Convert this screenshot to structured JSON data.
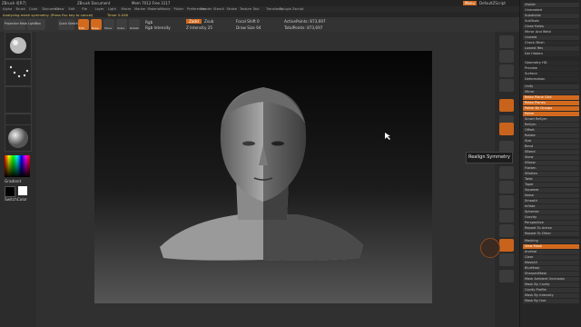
{
  "title_bar": {
    "app": "ZBrush 4[R7]",
    "doc": "ZBrush Document",
    "mem": "Mem 7012 Free 3117",
    "menu_btn": "Menu",
    "script_btn": "DefaultZScript"
  },
  "menus": [
    "Alpha",
    "Brush",
    "Color",
    "Document",
    "Draw",
    "Edit",
    "File",
    "Layer",
    "Light",
    "Macro",
    "Marker",
    "Material",
    "Movie",
    "Picker",
    "Preferences",
    "Render",
    "Stencil",
    "Stroke",
    "Texture",
    "Tool",
    "Transform",
    "Zplugin",
    "Zscript"
  ],
  "status": {
    "message": "Analyzing mesh symmetry. (Press Esc key to cancel)",
    "timer": "Timer 0.046"
  },
  "toolbar": {
    "rgb_label": "Rgb",
    "rgb_intensity": "Rgb Intensity",
    "zadd": "Zadd",
    "zsub": "Zsub",
    "z_intensity": "Z Intensity 25",
    "focal_shift": "Focal Shift 0",
    "draw_size": "Draw Size 64",
    "active_points": "ActivePoints: 873,697",
    "total_points": "TotalPoints: 873,697",
    "draw_btn": "Draw",
    "move_btn": "Move",
    "scale_btn": "Scale",
    "rotate_btn": "Rotate",
    "edit_btn": "Edit",
    "projection": "Projection Master",
    "lightbox": "LightBox",
    "quick_sketch": "Quick Sketch"
  },
  "left_panel": {
    "gradient_label": "Gradient",
    "switch_label": "SwitchColor"
  },
  "tooltip": "Realign Symmetry",
  "tray": {
    "top_buttons": [
      "Visible",
      "Unmasked",
      "Subdivide",
      "SubTools",
      "Close Holes",
      "Mirror And Weld",
      "Unweld",
      "Check Mesh",
      "Lowest Res",
      "Del Hidden"
    ],
    "sections": [
      "Geometry HD",
      "Preview",
      "Surface",
      "Deformation"
    ],
    "deform_items": [
      "Unify",
      "Mirror",
      "Relax Plane Grid",
      "Relax Planes",
      "Polish By Groups",
      "Polish",
      "Smart ReSym",
      "ReSym",
      "Offset",
      "Rotate",
      "Size",
      "Bend",
      "SBend",
      "Skew",
      "SSkew",
      "Flatten",
      "Sflatten",
      "Twist",
      "Taper",
      "Squeeze",
      "Noise",
      "Smooth",
      "Inflate",
      "Spherize",
      "Gravity",
      "Perspective",
      "Repeat To Active",
      "Repeat To Other"
    ],
    "masking": [
      "Masking",
      "View Mask",
      "Inverse",
      "Clear",
      "MaskAll",
      "BlurMask",
      "SharpenMask",
      "Mask Ambient Occlusion",
      "Mask By Cavity",
      "Cavity Profile",
      "Mask By Intensity",
      "Mask By Hue"
    ]
  }
}
